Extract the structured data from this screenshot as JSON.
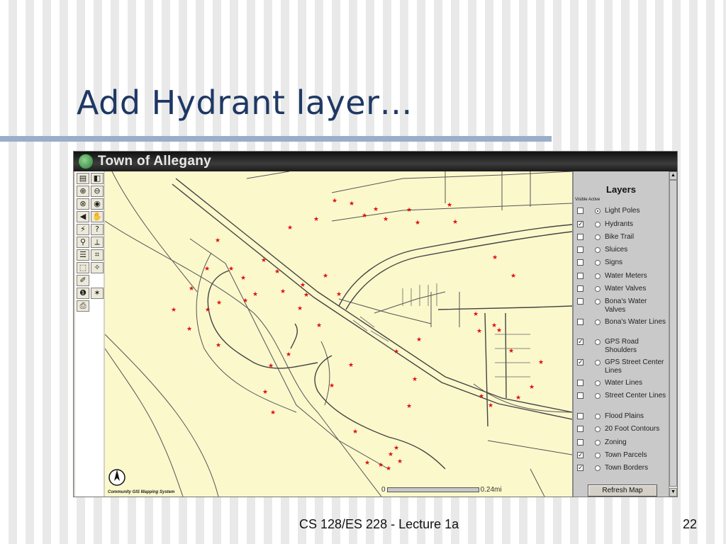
{
  "slide": {
    "title": "Add Hydrant layer…",
    "footer": "CS 128/ES 228 - Lecture 1a",
    "page_number": "22"
  },
  "app": {
    "window_title": "Town of Allegany",
    "credits": "Community GIS Mapping System",
    "scale_start": "0",
    "scale_end": "0.24mi",
    "colors": {
      "map_bg": "#fbf8cc",
      "hydrant": "#dd1111",
      "road": "#444444"
    }
  },
  "toolbar": {
    "tools": [
      {
        "icon": "overview-icon",
        "glyph": "▤"
      },
      {
        "icon": "legend-icon",
        "glyph": "◧"
      },
      {
        "icon": "zoom-in-icon",
        "glyph": "⊕"
      },
      {
        "icon": "zoom-out-icon",
        "glyph": "⊖"
      },
      {
        "icon": "zoom-full-icon",
        "glyph": "⊗"
      },
      {
        "icon": "zoom-active-icon",
        "glyph": "◉"
      },
      {
        "icon": "back-extent-icon",
        "glyph": "◀"
      },
      {
        "icon": "pan-hand-icon",
        "glyph": "✋"
      },
      {
        "icon": "hyperlink-icon",
        "glyph": "⚡"
      },
      {
        "icon": "identify-icon",
        "glyph": "?"
      },
      {
        "icon": "find-icon",
        "glyph": "⚲"
      },
      {
        "icon": "measure-icon",
        "glyph": "⟂"
      },
      {
        "icon": "select-icon",
        "glyph": "☰"
      },
      {
        "icon": "select-grid-icon",
        "glyph": "⌗"
      },
      {
        "icon": "select-rect-icon",
        "glyph": "⬚"
      },
      {
        "icon": "buffer-icon",
        "glyph": "✧"
      },
      {
        "icon": "clear-selection-icon",
        "glyph": "✐"
      },
      {
        "icon": "blank",
        "glyph": ""
      },
      {
        "icon": "info-icon",
        "glyph": "❶"
      },
      {
        "icon": "geocode-icon",
        "glyph": "✶"
      },
      {
        "icon": "print-icon",
        "glyph": "⎙"
      }
    ]
  },
  "layers": {
    "title": "Layers",
    "subhead": "Visible Active",
    "refresh_label": "Refresh Map",
    "items": [
      {
        "label": "Light Poles",
        "visible": false,
        "active": true
      },
      {
        "label": "Hydrants",
        "visible": true,
        "active": false
      },
      {
        "label": "Bike Trail",
        "visible": false,
        "active": false
      },
      {
        "label": "Sluices",
        "visible": false,
        "active": false
      },
      {
        "label": "Signs",
        "visible": false,
        "active": false
      },
      {
        "label": "Water Meters",
        "visible": false,
        "active": false
      },
      {
        "label": "Water Valves",
        "visible": false,
        "active": false
      },
      {
        "label": "Bona's Water Valves",
        "visible": false,
        "active": false
      },
      {
        "label": "Bona's Water Lines",
        "visible": false,
        "active": false
      },
      {
        "label": "GPS Road Shoulders",
        "visible": true,
        "active": false
      },
      {
        "label": "GPS Street Center Lines",
        "visible": true,
        "active": false
      },
      {
        "label": "Water Lines",
        "visible": false,
        "active": false
      },
      {
        "label": "Street Center Lines",
        "visible": false,
        "active": false
      },
      {
        "label": "Flood Plains",
        "visible": false,
        "active": false
      },
      {
        "label": "20 Foot Contours",
        "visible": false,
        "active": false
      },
      {
        "label": "Zoning",
        "visible": false,
        "active": false
      },
      {
        "label": "Town Parcels",
        "visible": true,
        "active": false
      },
      {
        "label": "Town Borders",
        "visible": true,
        "active": false
      }
    ]
  }
}
